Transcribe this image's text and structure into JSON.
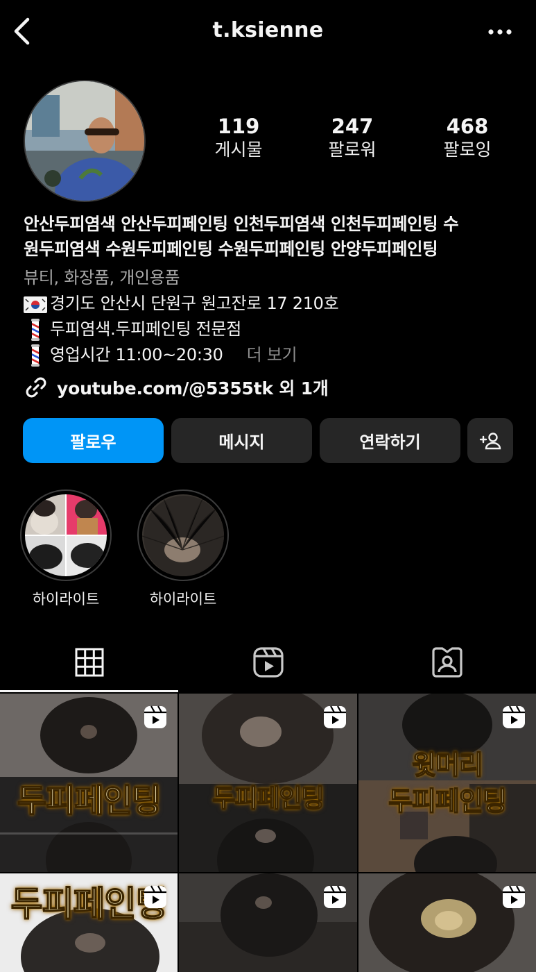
{
  "header": {
    "username": "t.ksienne"
  },
  "stats": [
    {
      "value": "119",
      "label": "게시물"
    },
    {
      "value": "247",
      "label": "팔로워"
    },
    {
      "value": "468",
      "label": "팔로잉"
    }
  ],
  "bio": {
    "name_line1": "안산두피염색 안산두피페인팅 인천두피염색 인천두피페인팅 수",
    "name_line2": "원두피염색 수원두피페인팅 수원두피페인팅 안양두피페인팅",
    "category": "뷰티, 화장품, 개인용품",
    "address": "경기도 안산시 단원구 원고잔로 17   210호",
    "specialty": "두피염색.두피페인팅 전문점",
    "hours": "영업시간 11:00~20:30",
    "more_label": "더 보기",
    "link": "youtube.com/@5355tk 외 1개"
  },
  "buttons": {
    "follow": "팔로우",
    "message": "메시지",
    "contact": "연락하기"
  },
  "highlights": [
    {
      "label": "하이라이트"
    },
    {
      "label": "하이라이트"
    }
  ],
  "grid_overlays": {
    "post1": "두피페인팅",
    "post2": "두피페인팅",
    "post3_top": "윗머리",
    "post3_bottom": "두피페인팅",
    "post4": "두피페인팅"
  },
  "colors": {
    "primary_button": "#0095f6",
    "secondary_button": "#262626",
    "background": "#000000",
    "muted_text": "#a8a8a8"
  },
  "icons": {
    "back": "chevron-left-icon",
    "more": "more-horizontal-icon",
    "link": "link-icon",
    "add_person": "add-person-icon",
    "grid_tab": "grid-icon",
    "reels_tab": "reels-icon",
    "tagged_tab": "tagged-icon",
    "reel_badge": "reel-icon"
  }
}
